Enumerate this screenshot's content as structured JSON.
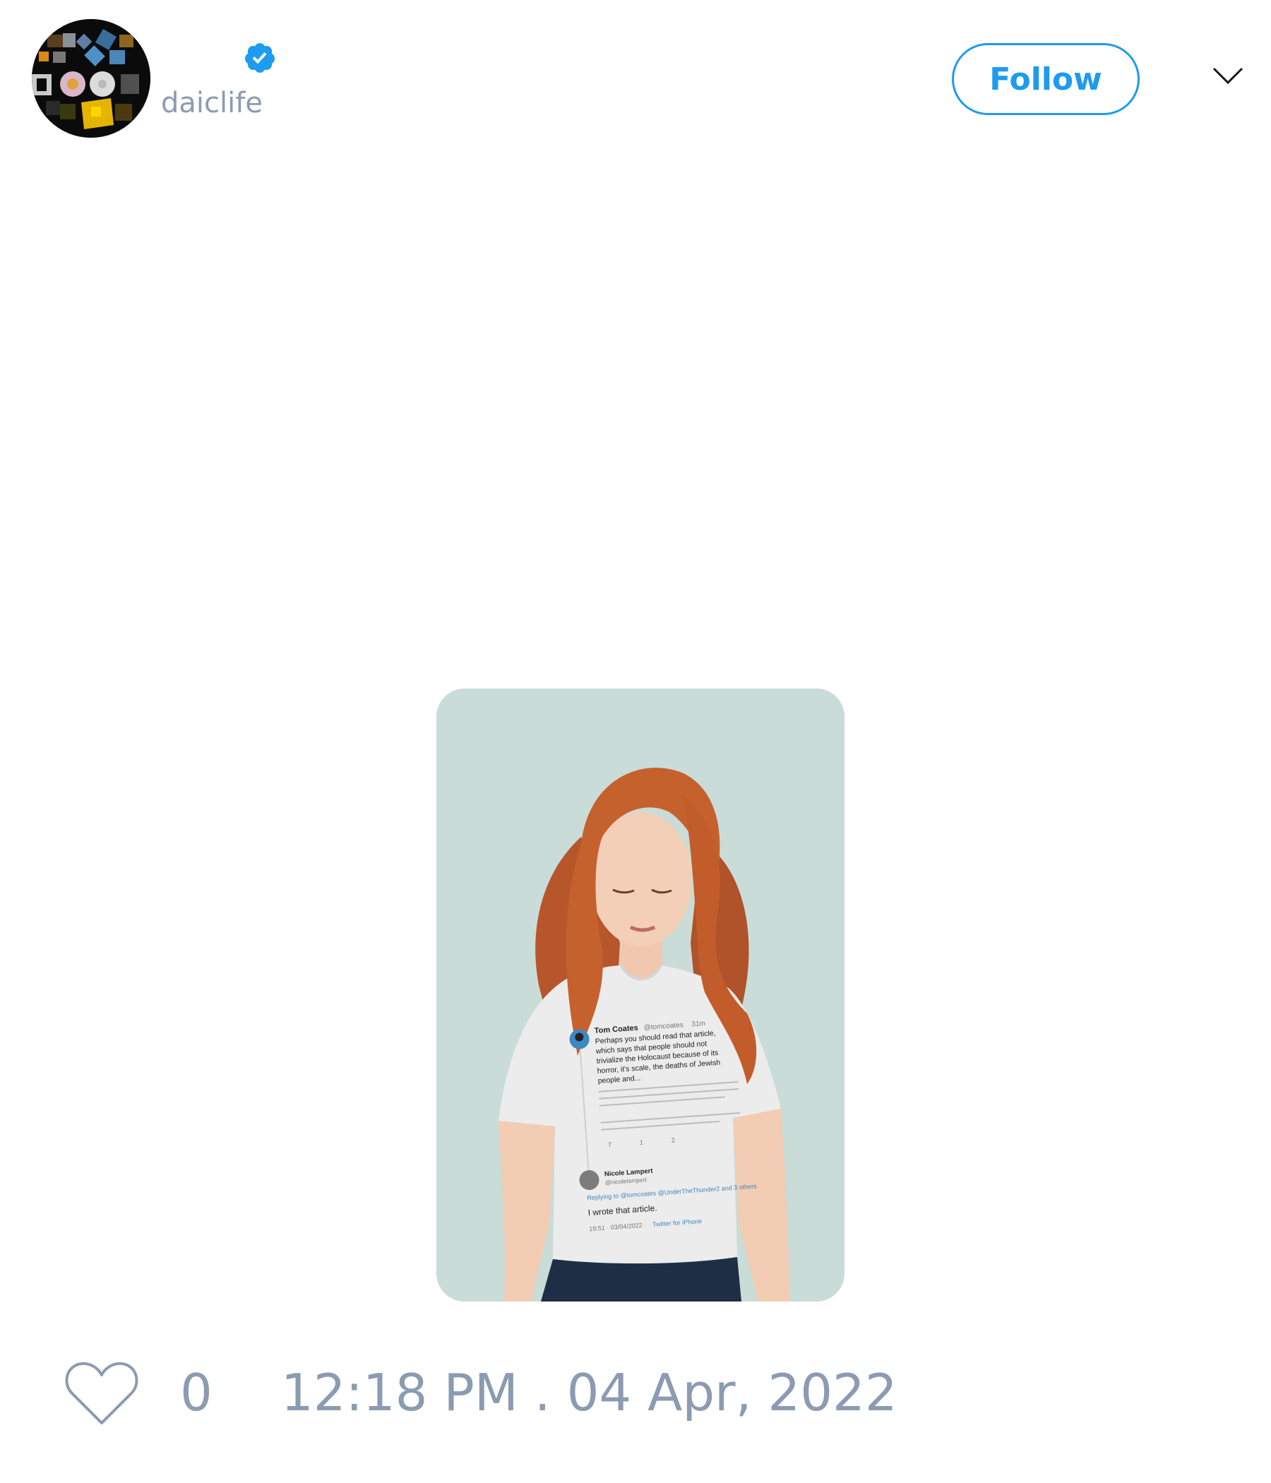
{
  "tweet": {
    "author": {
      "handle": "daiclife",
      "avatar_icon": "profile-collage-avatar",
      "verified_icon": "verified-badge-icon"
    },
    "follow_label": "Follow",
    "menu_icon": "chevron-down-icon",
    "media": {
      "kind": "photo",
      "subject": "woman-wearing-tweet-print-t-shirt",
      "shirt_print": {
        "original": {
          "name": "Tom Coates",
          "handle": "@tomcoates",
          "age": "31m",
          "lines": [
            "Perhaps you should read that article,",
            "which says that people should not",
            "trivialize the Holocaust because of its",
            "horror, it's scale, the deaths of Jewish",
            "people and..."
          ],
          "counts": [
            "7",
            "1",
            "2"
          ]
        },
        "reply": {
          "name": "Nicole Lampert",
          "handle": "@nicolelampert",
          "replying_to": "Replying to @tomcoates @UnderTheThunder2 and 3 others",
          "text": "I wrote that article.",
          "time": "19:51 · 03/04/2022 ·",
          "client": "Twitter for iPhone"
        }
      }
    },
    "likes": "0",
    "timestamp": "12:18 PM . 04 Apr, 2022",
    "like_icon": "heart-outline-icon"
  },
  "colors": {
    "accent": "#1d9bf0",
    "muted_text": "#8b9bb1",
    "media_background": "#cadcd7"
  }
}
